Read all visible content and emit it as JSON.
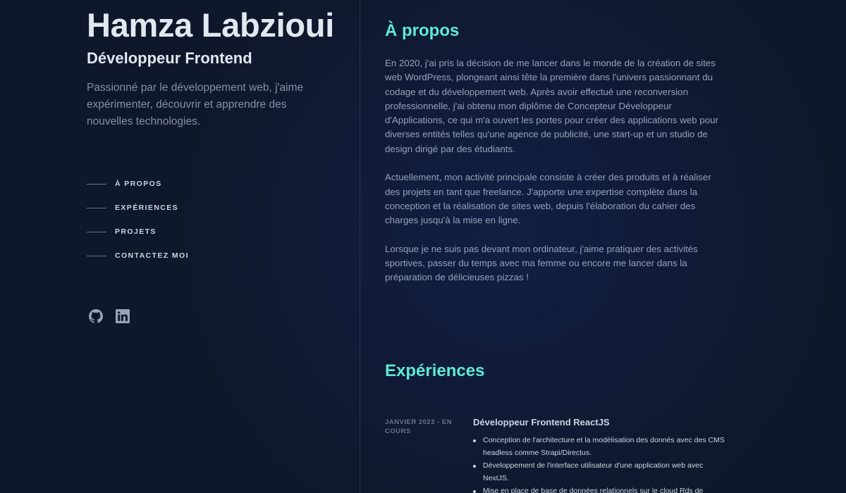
{
  "profile": {
    "name": "Hamza Labzioui",
    "role": "Développeur Frontend",
    "tagline": "Passionné par le développement web, j'aime expérimenter, découvrir et apprendre des nouvelles technologies."
  },
  "nav": [
    {
      "label": "À PROPOS"
    },
    {
      "label": "EXPÉRIENCES"
    },
    {
      "label": "PROJETS"
    },
    {
      "label": "CONTACTEZ MOI"
    }
  ],
  "socials": [
    {
      "icon": "github-icon"
    },
    {
      "icon": "linkedin-icon"
    }
  ],
  "about": {
    "heading": "À propos",
    "paragraphs": [
      "En 2020, j'ai pris la décision de me lancer dans le monde de la création de sites web WordPress, plongeant ainsi tête la première dans l'univers passionnant du codage et du développement web. Après avoir effectué une reconversion professionnelle, j'ai obtenu mon diplôme de Concepteur Développeur d'Applications, ce qui m'a ouvert les portes pour créer des applications web pour diverses entités telles qu'une agence de publicité, une start-up et un studio de design dirigé par des étudiants.",
      "Actuellement, mon activité principale consiste à créer des produits et à réaliser des projets en tant que freelance. J'apporte une expertise complète dans la conception et la réalisation de sites web, depuis l'élaboration du cahier des charges jusqu'à la mise en ligne.",
      "Lorsque je ne suis pas devant mon ordinateur, j'aime pratiquer des activités sportives, passer du temps avec ma femme ou encore me lancer dans la préparation de délicieuses pizzas !"
    ]
  },
  "experiences": {
    "heading": "Expériences",
    "items": [
      {
        "date": "JANVIER 2023 - EN COURS",
        "title": "Développeur Frontend ReactJS",
        "bullets": [
          "Conception de l'architecture et la modélisation des donnés avec des CMS headless comme Strapi/Directus.",
          "Développement de l'interface utilisateur d'une application web avec NextJS.",
          "Mise en place de base de données relationnels sur le cloud Rds de"
        ]
      }
    ]
  },
  "colors": {
    "background": "#0f172a",
    "accent": "#5eead4",
    "heading": "#e2e8f0",
    "text": "#94a3b8"
  }
}
